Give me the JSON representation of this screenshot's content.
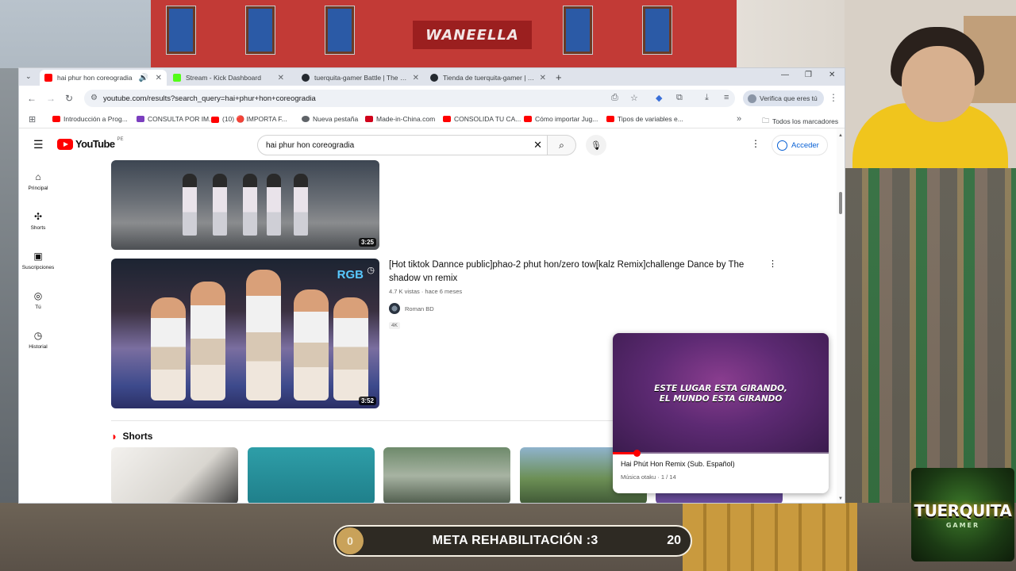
{
  "stream": {
    "building_sign": "WANEELLA",
    "goal": {
      "label": "META REHABILITACIÓN :3",
      "current": "0",
      "target": "20",
      "progress": 0
    },
    "brand": {
      "name": "TUERQUITA",
      "sub": "GAMER"
    }
  },
  "browser": {
    "tabs": [
      {
        "title": "hai phur hon coreogradia",
        "active": true,
        "fav_color": "#ff0000"
      },
      {
        "title": "Stream - Kick Dashboard",
        "active": false,
        "fav_color": "#53fc18"
      },
      {
        "title": "tuerquita-gamer Battle | The bi...",
        "active": false,
        "fav_color": "#24292f"
      },
      {
        "title": "Tienda de tuerquita-gamer | Th...",
        "active": false,
        "fav_color": "#24292f"
      }
    ],
    "new_tab": "+",
    "address": "youtube.com/results?search_query=hai+phur+hon+coreogradia",
    "profile_chip": "Verifica que eres tú",
    "bookmarks": [
      {
        "label": "Introducción a Prog...",
        "color": "#ff0000"
      },
      {
        "label": "CONSULTA POR IM...",
        "color": "#7b3fbf"
      },
      {
        "label": "(10) 🔴 IMPORTA F...",
        "color": "#ff0000"
      },
      {
        "label": "Nueva pestaña",
        "color": "#5f6368"
      },
      {
        "label": "Made-in-China.com",
        "color": "#d0021b"
      },
      {
        "label": "CONSOLIDA TU CA...",
        "color": "#ff0000"
      },
      {
        "label": "Cómo importar Jug...",
        "color": "#ff0000"
      },
      {
        "label": "Tipos de variables e...",
        "color": "#ff0000"
      }
    ],
    "all_bookmarks": "Todos los marcadores"
  },
  "youtube": {
    "logo_text": "YouTube",
    "country": "PE",
    "search_value": "hai phur hon coreogradia",
    "signin": "Acceder",
    "guide": [
      {
        "label": "Principal",
        "icon": "home-icon"
      },
      {
        "label": "Shorts",
        "icon": "shorts-icon"
      },
      {
        "label": "Suscripciones",
        "icon": "subscriptions-icon"
      },
      {
        "label": "Tú",
        "icon": "you-icon"
      },
      {
        "label": "Historial",
        "icon": "history-icon"
      }
    ],
    "results": [
      {
        "duration": "3:25"
      },
      {
        "duration": "3:52",
        "title": "[Hot tiktok Dannce public]phao-2 phut hon/zero tow[kalz Remix]challenge Dance by The shadow vn remix",
        "meta": "4.7 K vistas · hace 6 meses",
        "channel": "Roman BD",
        "badge": "4K",
        "thumb_logo": "RGB"
      }
    ],
    "shorts_heading": "Shorts",
    "miniplayer": {
      "lyric_line1": "ESTE LUGAR ESTA GIRANDO,",
      "lyric_line2": "EL MUNDO ESTA GIRANDO",
      "title": "Hai Phút Hon Remix (Sub. Español)",
      "subtitle": "Música otaku · 1 / 14",
      "progress": 0.11
    }
  }
}
